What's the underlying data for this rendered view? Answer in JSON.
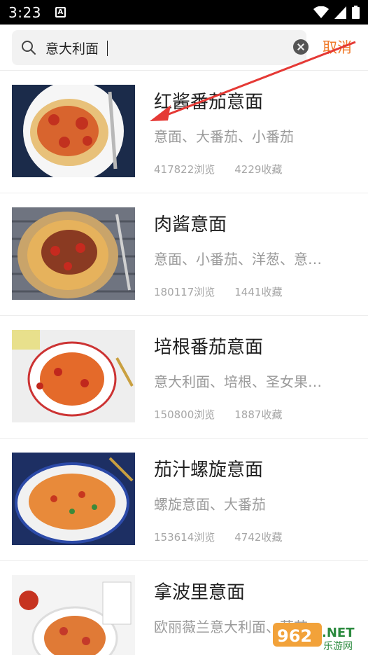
{
  "status_bar": {
    "time": "3:23",
    "notification_letter": "A"
  },
  "search": {
    "query": "意大利面",
    "cancel_label": "取消"
  },
  "results": [
    {
      "title": "红酱番茄意面",
      "tags": "意面、大番茄、小番茄",
      "views": "417822浏览",
      "favorites": "4229收藏"
    },
    {
      "title": "肉酱意面",
      "tags": "意面、小番茄、洋葱、意…",
      "views": "180117浏览",
      "favorites": "1441收藏"
    },
    {
      "title": "培根番茄意面",
      "tags": "意大利面、培根、圣女果…",
      "views": "150800浏览",
      "favorites": "1887收藏"
    },
    {
      "title": "茄汁螺旋意面",
      "tags": "螺旋意面、大番茄",
      "views": "153614浏览",
      "favorites": "4742收藏"
    },
    {
      "title": "拿波里意面",
      "tags": "欧丽薇兰意大利面、蒜苗",
      "views": "",
      "favorites": ""
    }
  ],
  "watermark": {
    "brand_number": "962",
    "brand_suffix": ".NET",
    "brand_sub": "乐游网"
  },
  "colors": {
    "accent": "#f07a29",
    "annotation_arrow": "#e53935"
  }
}
